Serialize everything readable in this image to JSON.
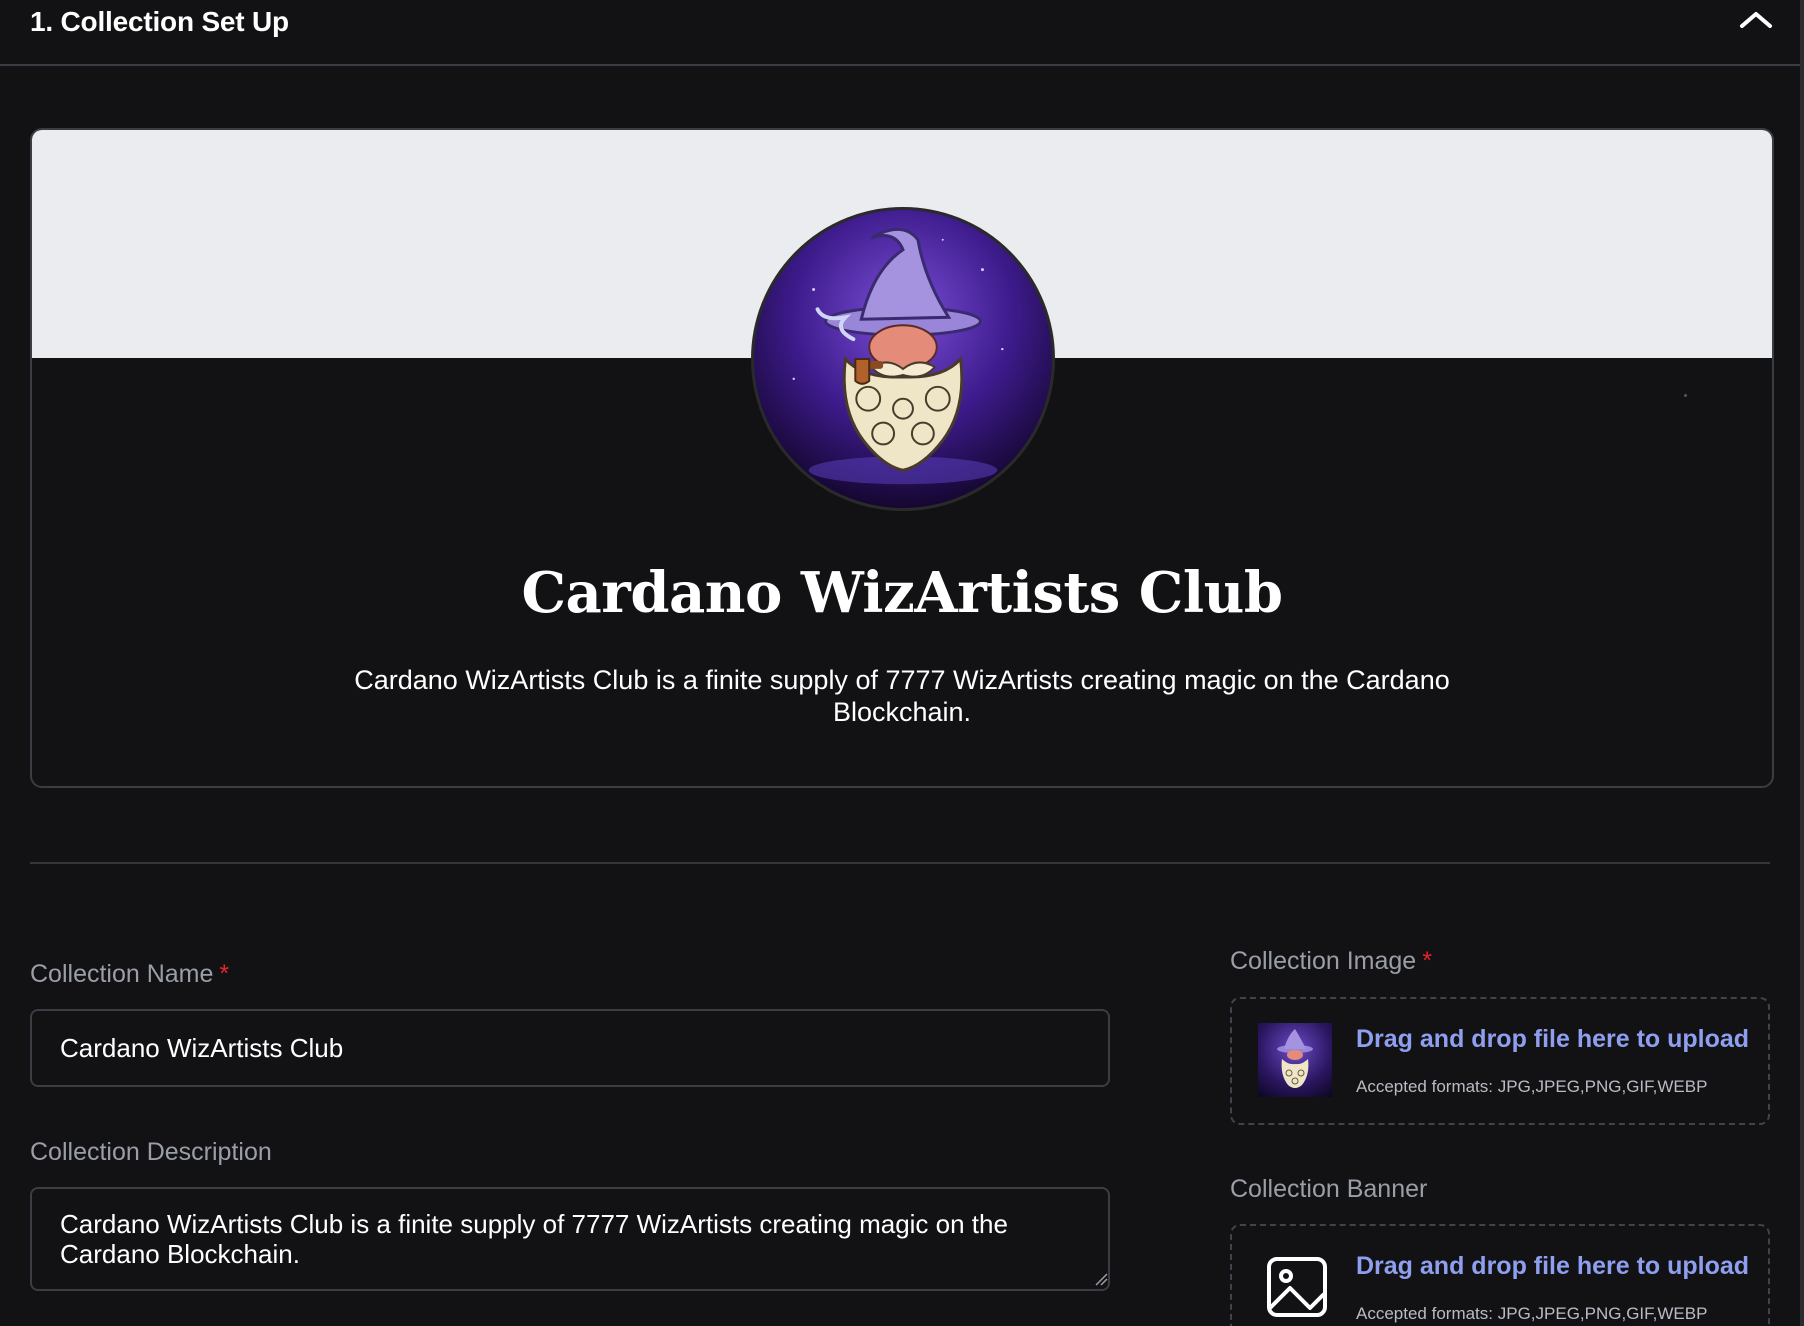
{
  "section": {
    "title": "1. Collection Set Up",
    "collapse_icon": "chevron-up-icon"
  },
  "preview": {
    "title": "Cardano WizArtists Club",
    "description": "Cardano WizArtists Club is a finite supply of 7777 WizArtists creating magic on the Cardano Blockchain.",
    "banner_color": "#ebecef",
    "avatar_icon": "wizard-avatar-image"
  },
  "form": {
    "name": {
      "label": "Collection Name",
      "required_mark": "*",
      "value": "Cardano WizArtists Club"
    },
    "description": {
      "label": "Collection Description",
      "value": "Cardano WizArtists Club is a finite supply of 7777 WizArtists creating magic on the Cardano Blockchain."
    },
    "image": {
      "label": "Collection Image",
      "required_mark": "*",
      "cta": "Drag and drop file here to upload",
      "formats": "Accepted formats: JPG,JPEG,PNG,GIF,WEBP",
      "thumb_icon": "wizard-thumbnail-image"
    },
    "banner": {
      "label": "Collection Banner",
      "cta": "Drag and drop file here to upload",
      "formats": "Accepted formats: JPG,JPEG,PNG,GIF,WEBP",
      "placeholder_icon": "image-placeholder-icon"
    }
  },
  "colors": {
    "background": "#121214",
    "border": "#3a3d44",
    "accent_link": "#8f9ff0",
    "required": "#e5252a",
    "label": "#9a9ea6"
  }
}
